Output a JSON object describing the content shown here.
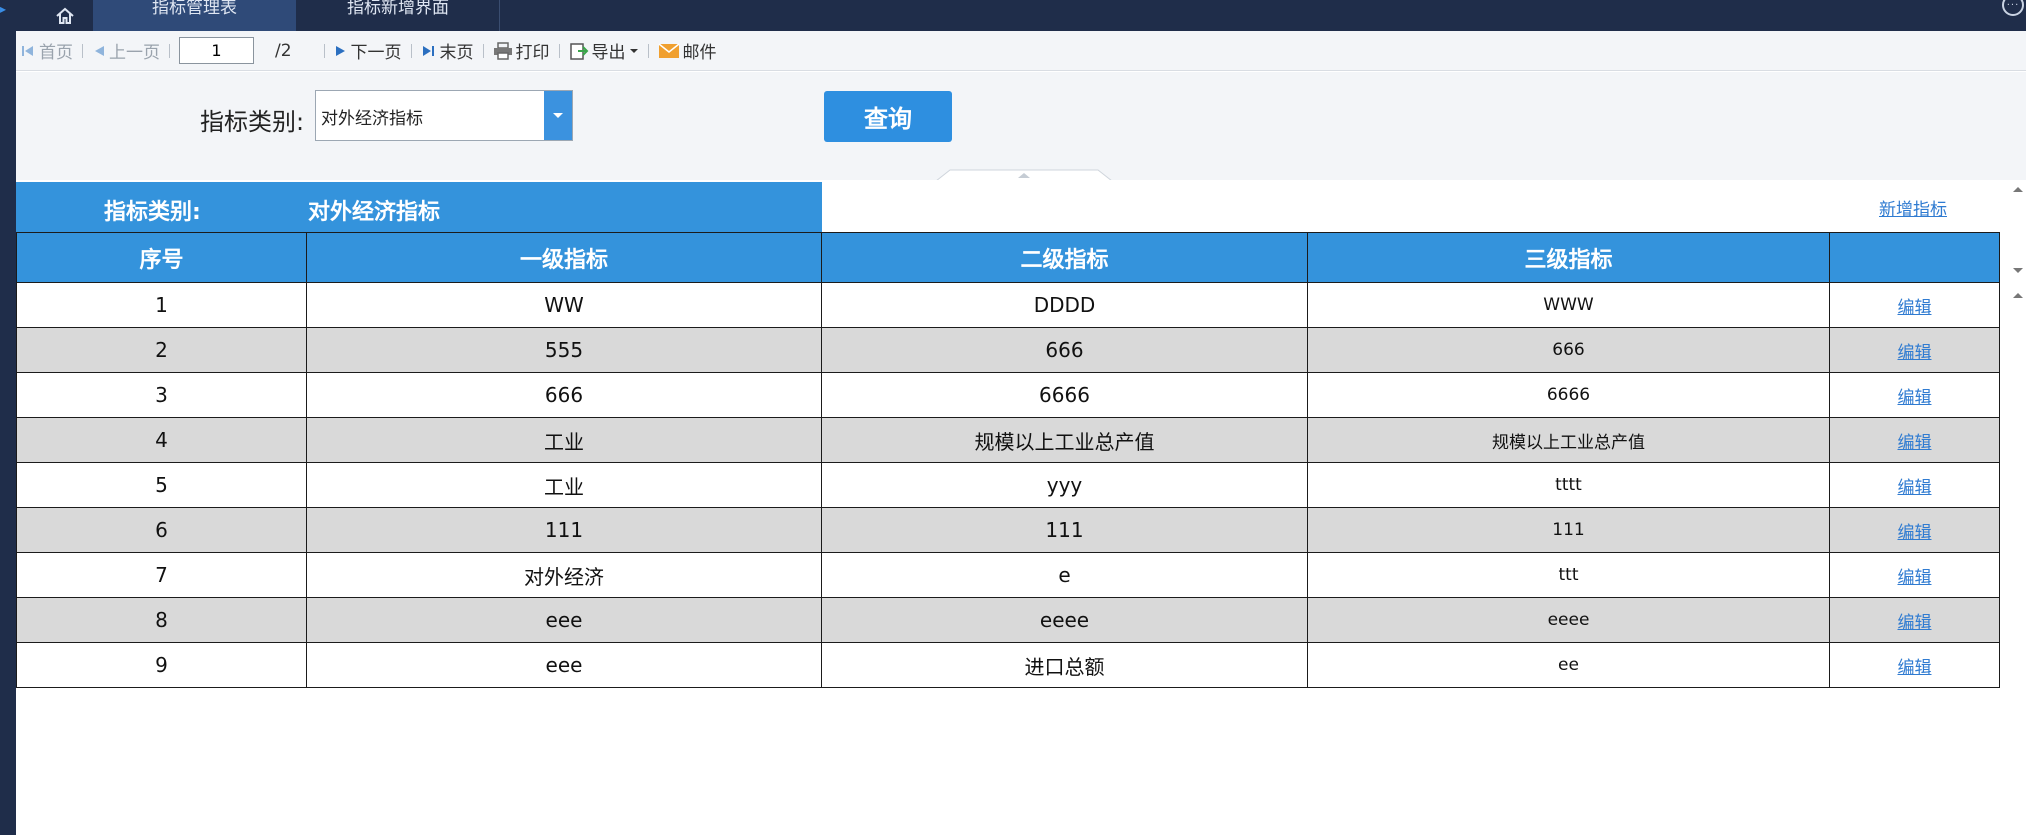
{
  "topbar": {
    "tabs": [
      {
        "label": "指标管理表",
        "active": true
      },
      {
        "label": "指标新增界面",
        "active": false
      }
    ],
    "home_icon": "home-icon",
    "more_icon": "more-circle-icon"
  },
  "toolbar": {
    "first": "首页",
    "prev": "上一页",
    "page_value": "1",
    "page_total": "/2",
    "next": "下一页",
    "last": "末页",
    "print": "打印",
    "export": "导出",
    "mail": "邮件"
  },
  "filter": {
    "label": "指标类别:",
    "selected": "对外经济指标",
    "query_button": "查询"
  },
  "report": {
    "category_label": "指标类别:",
    "category_value": "对外经济指标",
    "add_link": "新增指标",
    "columns": [
      "序号",
      "一级指标",
      "二级指标",
      "三级指标",
      ""
    ],
    "rows": [
      {
        "no": "1",
        "l1": "WW",
        "l2": "DDDD",
        "l3": "WWW",
        "action": "编辑"
      },
      {
        "no": "2",
        "l1": "555",
        "l2": "666",
        "l3": "666",
        "action": "编辑"
      },
      {
        "no": "3",
        "l1": "666",
        "l2": "6666",
        "l3": "6666",
        "action": "编辑"
      },
      {
        "no": "4",
        "l1": "工业",
        "l2": "规模以上工业总产值",
        "l3": "规模以上工业总产值",
        "action": "编辑"
      },
      {
        "no": "5",
        "l1": "工业",
        "l2": "yyy",
        "l3": "tttt",
        "action": "编辑"
      },
      {
        "no": "6",
        "l1": "111",
        "l2": "111",
        "l3": "111",
        "action": "编辑"
      },
      {
        "no": "7",
        "l1": "对外经济",
        "l2": "e",
        "l3": "ttt",
        "action": "编辑"
      },
      {
        "no": "8",
        "l1": "eee",
        "l2": "eeee",
        "l3": "eeee",
        "action": "编辑"
      },
      {
        "no": "9",
        "l1": "eee",
        "l2": "进口总额",
        "l3": "ee",
        "action": "编辑"
      }
    ]
  },
  "colors": {
    "header_blue": "#3493dc",
    "topbar_bg": "#1f2d4a",
    "alt_row": "#d9d9d9",
    "link": "#2f7bd1"
  }
}
